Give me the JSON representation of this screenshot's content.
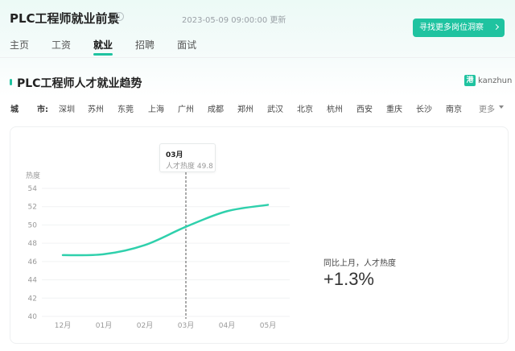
{
  "header": {
    "title": "PLC工程师就业前景",
    "info_icon": "info-icon",
    "timestamp": "2023-05-09 09:00:00 更新",
    "find_button": "寻找更多岗位洞察"
  },
  "tabs": [
    {
      "label": "主页",
      "active": false
    },
    {
      "label": "工资",
      "active": false
    },
    {
      "label": "就业",
      "active": true
    },
    {
      "label": "招聘",
      "active": false
    },
    {
      "label": "面试",
      "active": false
    }
  ],
  "section": {
    "title": "PLC工程师人才就业趋势",
    "brand_logo": "港",
    "brand_name": "kanzhun"
  },
  "city_filter": {
    "label_a": "城",
    "label_b": "市:",
    "cities": [
      "深圳",
      "苏州",
      "东莞",
      "上海",
      "广州",
      "成都",
      "郑州",
      "武汉",
      "北京",
      "杭州",
      "西安",
      "重庆",
      "长沙",
      "南京"
    ],
    "more": "更多"
  },
  "tooltip": {
    "month": "03月",
    "text": "人才热度 49.8"
  },
  "stat": {
    "label": "同比上月，人才热度",
    "value": "+1.3%"
  },
  "colors": {
    "accent": "#1fc3a0",
    "line": "#2fd0ac"
  },
  "chart_data": {
    "type": "line",
    "ylabel": "热度",
    "categories": [
      "12月",
      "01月",
      "02月",
      "03月",
      "04月",
      "05月"
    ],
    "series": [
      {
        "values": [
          46.7,
          46.8,
          47.8,
          49.8,
          51.5,
          52.2
        ]
      }
    ],
    "ylim": [
      40,
      54
    ],
    "yticks": [
      40,
      42,
      44,
      46,
      48,
      50,
      52,
      54
    ],
    "highlight_index": 3,
    "grid": true
  }
}
